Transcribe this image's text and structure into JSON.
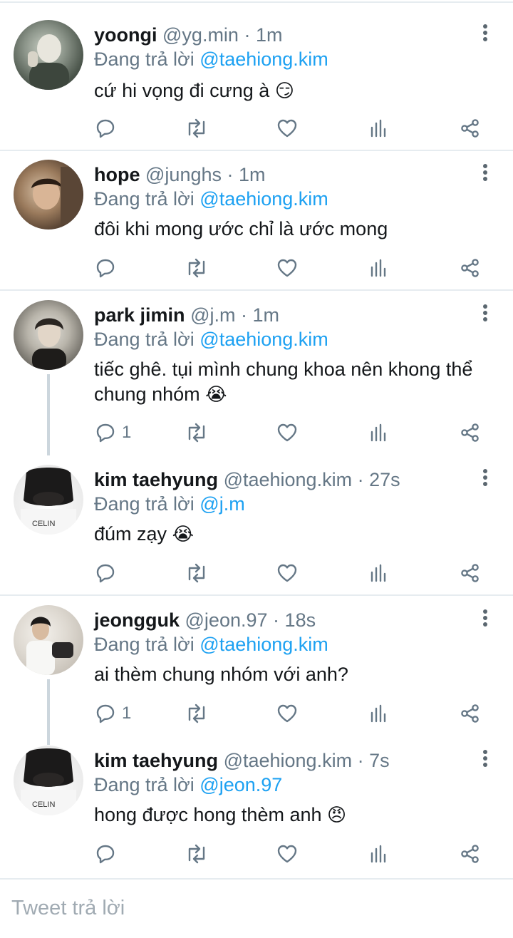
{
  "tweets": [
    {
      "name": "yoongi",
      "handle": "@yg.min",
      "time": "1m",
      "reply_prefix": "Đang trả lời",
      "mention": "@taehiong.kim",
      "text": "cứ hi vọng đi cưng à",
      "emoji": "😏",
      "replies": ""
    },
    {
      "name": "hope",
      "handle": "@junghs",
      "time": "1m",
      "reply_prefix": "Đang trả lời",
      "mention": "@taehiong.kim",
      "text": "đôi khi mong ước chỉ là ước mong",
      "emoji": "",
      "replies": ""
    },
    {
      "name": "park jimin",
      "handle": "@j.m",
      "time": "1m",
      "reply_prefix": "Đang trả lời",
      "mention": "@taehiong.kim",
      "text": "tiếc ghê. tụi mình chung khoa nên khong thể chung nhóm",
      "emoji": "😭",
      "replies": "1"
    },
    {
      "name": "kim taehyung",
      "handle": "@taehiong.kim",
      "time": "27s",
      "reply_prefix": "Đang trả lời",
      "mention": "@j.m",
      "text": "đúm zạy",
      "emoji": "😭",
      "replies": ""
    },
    {
      "name": "jeongguk",
      "handle": "@jeon.97",
      "time": "18s",
      "reply_prefix": "Đang trả lời",
      "mention": "@taehiong.kim",
      "text": "ai thèm chung nhóm với anh?",
      "emoji": "",
      "replies": "1"
    },
    {
      "name": "kim taehyung",
      "handle": "@taehiong.kim",
      "time": "7s",
      "reply_prefix": "Đang trả lời",
      "mention": "@jeon.97",
      "text": "hong được hong thèm anh",
      "emoji": "😠",
      "replies": ""
    }
  ],
  "separator": "·",
  "composer": {
    "placeholder": "Tweet trả lời"
  },
  "colors": {
    "accent": "#1da1f2",
    "muted": "#657786",
    "divider": "#e6ecf0",
    "thread_line": "#ccd6dd"
  },
  "icons": [
    "reply-icon",
    "retweet-icon",
    "like-icon",
    "analytics-icon",
    "share-icon",
    "more-icon"
  ]
}
